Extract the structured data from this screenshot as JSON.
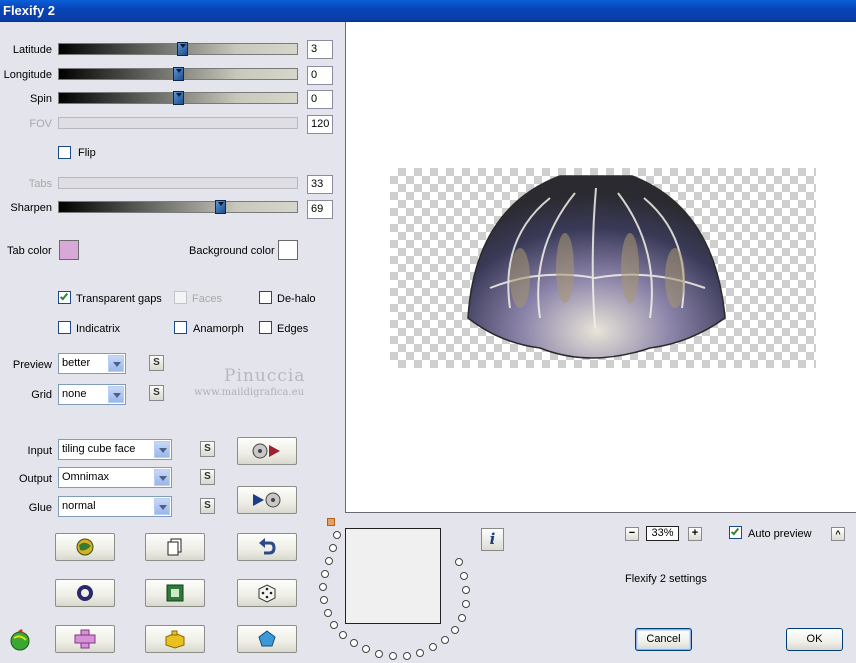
{
  "window": {
    "title": "Flexify 2"
  },
  "sliders": {
    "latitude": {
      "label": "Latitude",
      "value": "3",
      "enabled": true,
      "position": 0.51
    },
    "longitude": {
      "label": "Longitude",
      "value": "0",
      "enabled": true,
      "position": 0.5
    },
    "spin": {
      "label": "Spin",
      "value": "0",
      "enabled": true,
      "position": 0.5
    },
    "fov": {
      "label": "FOV",
      "value": "120",
      "enabled": false
    },
    "tabs": {
      "label": "Tabs",
      "value": "33",
      "enabled": false
    },
    "sharpen": {
      "label": "Sharpen",
      "value": "69",
      "enabled": true,
      "position": 0.69
    }
  },
  "flip": {
    "label": "Flip",
    "checked": false
  },
  "tab_color": {
    "label": "Tab color",
    "color": "#d8a8d8"
  },
  "background_color": {
    "label": "Background color",
    "color": "#ffffff"
  },
  "options": {
    "transparent_gaps": {
      "label": "Transparent gaps",
      "checked": true
    },
    "faces": {
      "label": "Faces",
      "checked": false,
      "enabled": false
    },
    "de_halo": {
      "label": "De-halo",
      "checked": false
    },
    "indicatrix": {
      "label": "Indicatrix",
      "checked": false
    },
    "anamorph": {
      "label": "Anamorph",
      "checked": false
    },
    "edges": {
      "label": "Edges",
      "checked": false
    }
  },
  "preview_select": {
    "label": "Preview",
    "value": "better"
  },
  "grid_select": {
    "label": "Grid",
    "value": "none"
  },
  "input_select": {
    "label": "Input",
    "value": "tiling cube face"
  },
  "output_select": {
    "label": "Output",
    "value": "Omnimax"
  },
  "glue_select": {
    "label": "Glue",
    "value": "normal"
  },
  "small_button_label": "S",
  "watermark": {
    "line1": "Pinuccia",
    "line2": "www.maildigrafica.eu"
  },
  "info_button": "i",
  "zoom": {
    "value": "33%",
    "minus": "−",
    "plus": "+"
  },
  "auto_preview": {
    "label": "Auto preview",
    "checked": true
  },
  "collapse_button": "^",
  "settings_label": "Flexify 2 settings",
  "buttons": {
    "cancel": "Cancel",
    "ok": "OK"
  },
  "colors": {
    "title_bar": "#0a4fc8",
    "panel": "#e4e4ec"
  }
}
